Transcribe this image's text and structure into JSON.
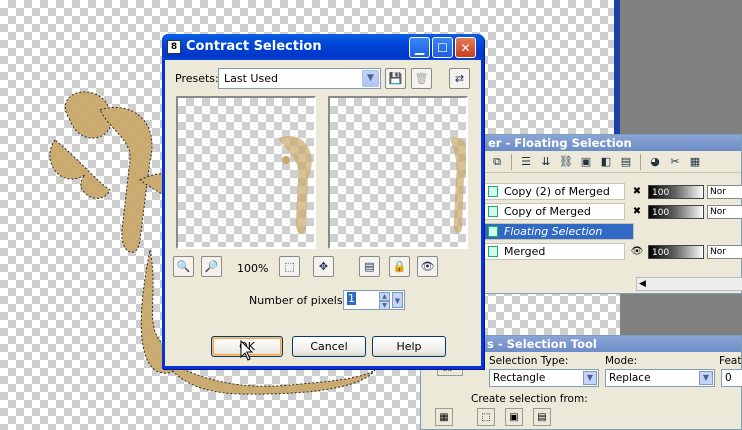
{
  "dialog": {
    "title": "Contract Selection",
    "presets_label": "Presets:",
    "presets_value": "Last Used",
    "zoom_percent": "100%",
    "pixels_label": "Number of pixels:",
    "pixels_value": "1",
    "ok_label": "OK",
    "cancel_label": "Cancel",
    "help_label": "Help"
  },
  "layers_palette": {
    "title": "er - Floating Selection",
    "layers": [
      {
        "name": "Copy (2) of Merged",
        "opacity": "100",
        "blend": "Nor",
        "selected": false
      },
      {
        "name": "Copy of Merged",
        "opacity": "100",
        "blend": "Nor",
        "selected": false
      },
      {
        "name": "Floating Selection",
        "opacity": "",
        "blend": "",
        "selected": true
      },
      {
        "name": "Merged",
        "opacity": "100",
        "blend": "Nor",
        "selected": false
      }
    ]
  },
  "tool_options": {
    "title": "s - Selection Tool",
    "selection_type_label": "Selection Type:",
    "selection_type_value": "Rectangle",
    "mode_label": "Mode:",
    "mode_value": "Replace",
    "feather_label": "Feath",
    "feather_value": "0",
    "create_from_label": "Create selection from:"
  },
  "colors": {
    "title_bar": "#0145d6",
    "panel_bg": "#ece9d8",
    "selected_layer": "#316ac5",
    "art_gold": "#c9a86a"
  }
}
